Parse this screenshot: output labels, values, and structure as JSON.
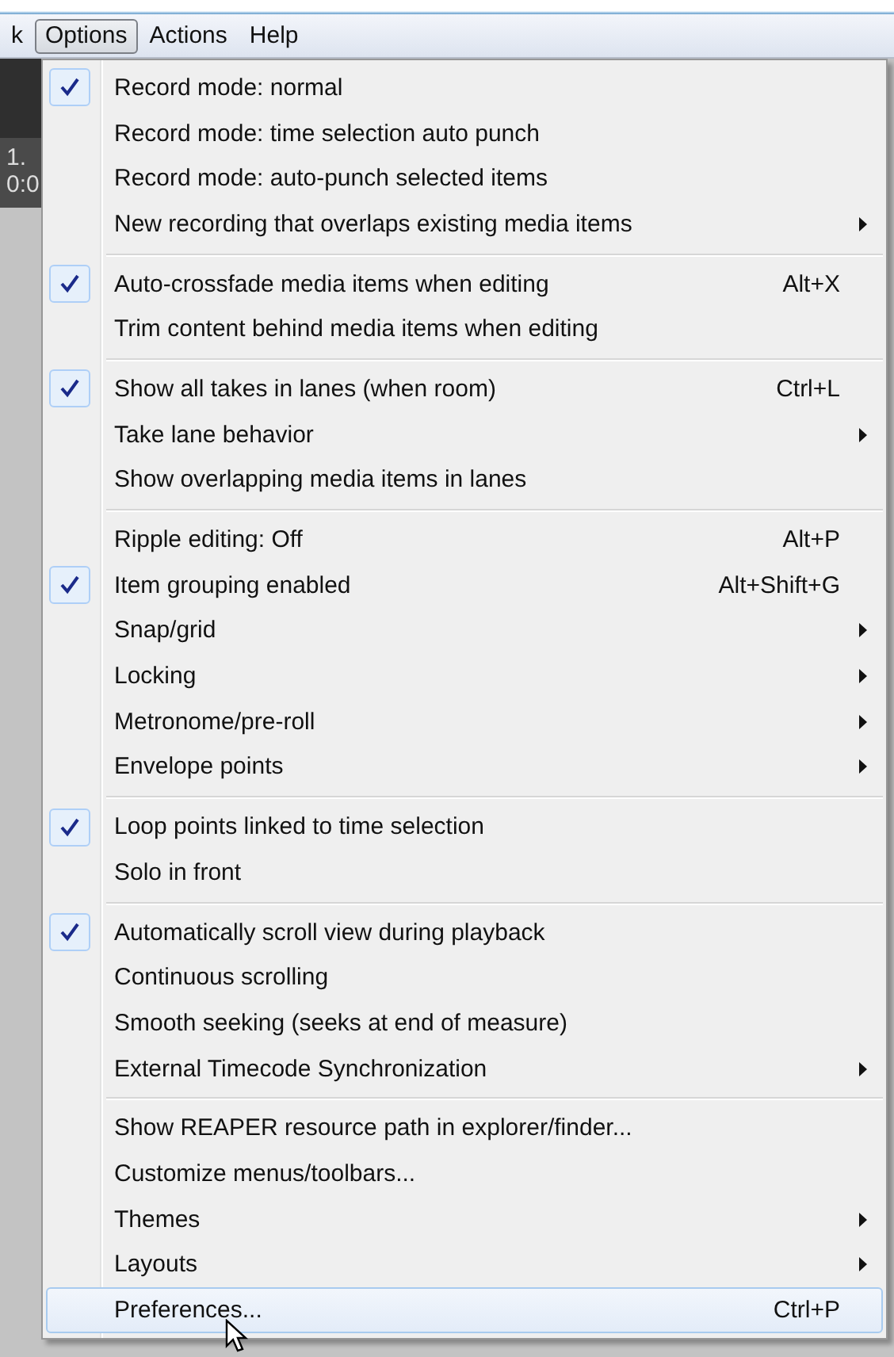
{
  "menu_bar": [
    {
      "label": "k",
      "selected": false
    },
    {
      "label": "Options",
      "selected": true
    },
    {
      "label": "Actions",
      "selected": false
    },
    {
      "label": "Help",
      "selected": false
    }
  ],
  "background_texts": [
    "1.",
    "0:0"
  ],
  "menu_groups": [
    {
      "items": [
        {
          "label": "Record mode: normal",
          "checked": true,
          "submenu": false,
          "selected": false
        },
        {
          "label": "Record mode: time selection auto punch",
          "checked": false,
          "submenu": false,
          "selected": false
        },
        {
          "label": "Record mode: auto-punch selected items",
          "checked": false,
          "submenu": false,
          "selected": false
        },
        {
          "label": "New recording that overlaps existing media items",
          "checked": false,
          "submenu": true,
          "selected": false
        }
      ]
    },
    {
      "items": [
        {
          "label": "Auto-crossfade media items when editing",
          "shortcut": "Alt+X",
          "checked": true,
          "submenu": false,
          "selected": false
        },
        {
          "label": "Trim content behind media items when editing",
          "checked": false,
          "submenu": false,
          "selected": false
        }
      ]
    },
    {
      "items": [
        {
          "label": "Show all takes in lanes (when room)",
          "shortcut": "Ctrl+L",
          "checked": true,
          "submenu": false,
          "selected": false
        },
        {
          "label": "Take lane behavior",
          "checked": false,
          "submenu": true,
          "selected": false
        },
        {
          "label": "Show overlapping media items in lanes",
          "checked": false,
          "submenu": false,
          "selected": false
        }
      ]
    },
    {
      "items": [
        {
          "label": "Ripple editing: Off",
          "shortcut": "Alt+P",
          "checked": false,
          "submenu": false,
          "selected": false
        },
        {
          "label": "Item grouping enabled",
          "shortcut": "Alt+Shift+G",
          "checked": true,
          "submenu": false,
          "selected": false
        },
        {
          "label": "Snap/grid",
          "checked": false,
          "submenu": true,
          "selected": false
        },
        {
          "label": "Locking",
          "checked": false,
          "submenu": true,
          "selected": false
        },
        {
          "label": "Metronome/pre-roll",
          "checked": false,
          "submenu": true,
          "selected": false
        },
        {
          "label": "Envelope points",
          "checked": false,
          "submenu": true,
          "selected": false
        }
      ]
    },
    {
      "items": [
        {
          "label": "Loop points linked to time selection",
          "checked": true,
          "submenu": false,
          "selected": false
        },
        {
          "label": "Solo in front",
          "checked": false,
          "submenu": false,
          "selected": false
        }
      ]
    },
    {
      "items": [
        {
          "label": "Automatically scroll view during playback",
          "checked": true,
          "submenu": false,
          "selected": false
        },
        {
          "label": "Continuous scrolling",
          "checked": false,
          "submenu": false,
          "selected": false
        },
        {
          "label": "Smooth seeking (seeks at end of measure)",
          "checked": false,
          "submenu": false,
          "selected": false
        },
        {
          "label": "External Timecode Synchronization",
          "checked": false,
          "submenu": true,
          "selected": false
        }
      ]
    },
    {
      "items": [
        {
          "label": "Show REAPER resource path in explorer/finder...",
          "checked": false,
          "submenu": false,
          "selected": false
        },
        {
          "label": "Customize menus/toolbars...",
          "checked": false,
          "submenu": false,
          "selected": false
        },
        {
          "label": "Themes",
          "checked": false,
          "submenu": true,
          "selected": false
        },
        {
          "label": "Layouts",
          "checked": false,
          "submenu": true,
          "selected": false
        },
        {
          "label": "Preferences...",
          "shortcut": "Ctrl+P",
          "checked": false,
          "submenu": false,
          "selected": true
        }
      ]
    }
  ]
}
